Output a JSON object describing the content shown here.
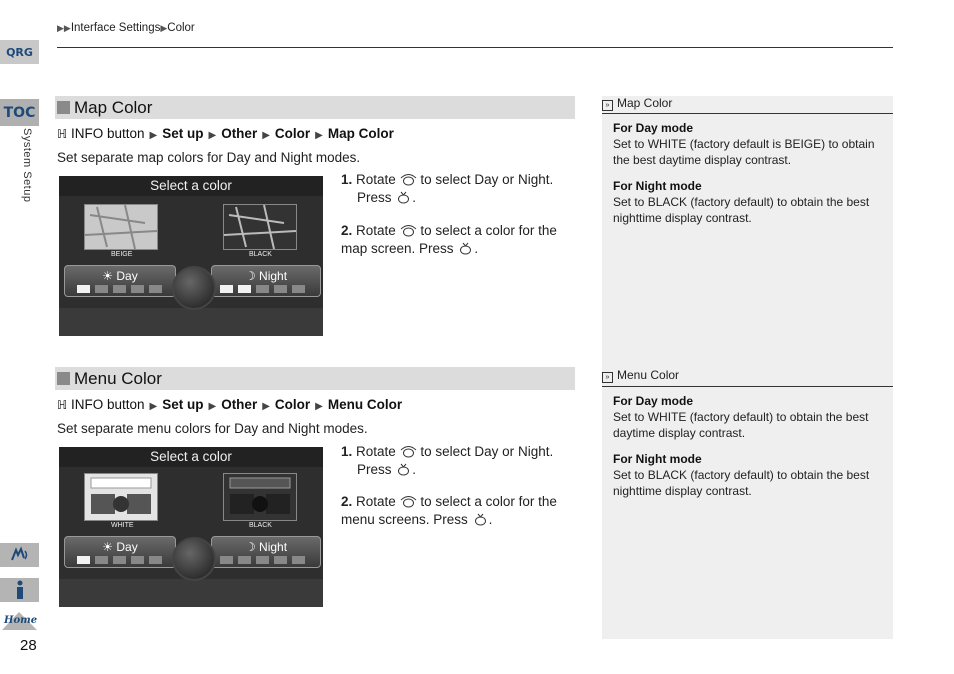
{
  "breadcrumb": {
    "items": [
      "Interface Settings",
      "Color"
    ]
  },
  "left_rail": {
    "qrg": "QRG",
    "toc": "TOC",
    "section_label": "System Setup",
    "page_number": "28",
    "home_label": "Home"
  },
  "map_color": {
    "heading": "Map Color",
    "path": {
      "info": "INFO button",
      "steps": [
        "Set up",
        "Other",
        "Color",
        "Map Color"
      ]
    },
    "description": "Set separate map colors for Day and Night modes.",
    "screen": {
      "title": "Select a color",
      "left_label": "BEIGE",
      "right_label": "BLACK",
      "day": "Day",
      "night": "Night"
    },
    "step1": {
      "num": "1.",
      "pre": "Rotate",
      "mid": "to select",
      "day": "Day",
      "or": "or",
      "night": "Night",
      "press": "Press"
    },
    "step2": {
      "num": "2.",
      "pre": "Rotate",
      "text": "to select a color for the map screen. Press"
    }
  },
  "menu_color": {
    "heading": "Menu Color",
    "path": {
      "info": "INFO button",
      "steps": [
        "Set up",
        "Other",
        "Color",
        "Menu Color"
      ]
    },
    "description": "Set separate menu colors for Day and Night modes.",
    "screen": {
      "title": "Select a color",
      "left_label": "WHITE",
      "right_label": "BLACK",
      "day": "Day",
      "night": "Night"
    },
    "step1": {
      "num": "1.",
      "pre": "Rotate",
      "mid": "to select",
      "day": "Day",
      "or": "or",
      "night": "Night",
      "press": "Press"
    },
    "step2": {
      "num": "2.",
      "pre": "Rotate",
      "text": "to select a color for the menu screens. Press"
    }
  },
  "sidebar": {
    "map": {
      "title": "Map Color",
      "day_heading": "For Day mode",
      "day_text_1": "Set to",
      "day_white": "WHITE",
      "day_text_2": "(factory default is",
      "day_beige": "BEIGE",
      "day_text_3": ") to obtain the best daytime display contrast.",
      "night_heading": "For Night mode",
      "night_text_1": "Set to",
      "night_black": "BLACK",
      "night_text_2": "(factory default) to obtain the best nighttime display contrast."
    },
    "menu": {
      "title": "Menu Color",
      "day_heading": "For Day mode",
      "day_text_1": "Set to",
      "day_white": "WHITE",
      "day_text_2": "(factory default) to obtain the best daytime display contrast.",
      "night_heading": "For Night mode",
      "night_text_1": "Set to",
      "night_black": "BLACK",
      "night_text_2": "(factory default) to obtain the best nighttime display contrast."
    }
  },
  "colors": {
    "accent": "#1e4a7a",
    "section_bar": "#dcdcdc",
    "sidebar_bg": "#efefef"
  }
}
